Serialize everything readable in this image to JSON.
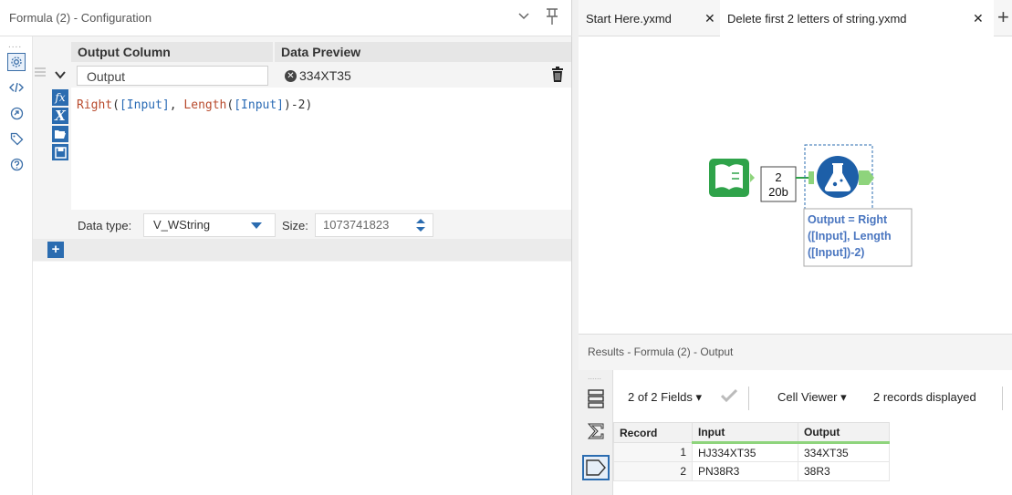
{
  "config_panel": {
    "title": "Formula (2) - Configuration",
    "columns": {
      "output_column": "Output Column",
      "data_preview": "Data Preview"
    },
    "row": {
      "output_field": "Output",
      "preview_value": "334XT35",
      "expression": {
        "fn1": "Right",
        "p1": "(",
        "f1": "[Input]",
        "c1": ", ",
        "fn2": "Length",
        "p2": "(",
        "f2": "[Input]",
        "p3": ")",
        "minus": "-",
        "n": "2",
        "p4": ")"
      },
      "data_type_label": "Data type:",
      "data_type": "V_WString",
      "size_label": "Size:",
      "size_value": "1073741823"
    },
    "add_label": "+"
  },
  "tabs": [
    {
      "label": "Start Here.yxmd",
      "active": false
    },
    {
      "label": "Delete first 2 letters of string.yxmd",
      "active": true
    }
  ],
  "canvas": {
    "connection_count": "2",
    "connection_size": "20b",
    "annotation_line1": "Output = Right",
    "annotation_line2": "([Input], Length",
    "annotation_line3": "([Input])-2)"
  },
  "results": {
    "title": "Results - Formula (2) - Output",
    "fields_label": "2 of 2 Fields",
    "cell_viewer_label": "Cell Viewer",
    "records_label": "2 records displayed",
    "headers": [
      "Record",
      "Input",
      "Output"
    ],
    "rows": [
      {
        "record": "1",
        "input": "HJ334XT35",
        "output": "334XT35"
      },
      {
        "record": "2",
        "input": "PN38R3",
        "output": "38R3"
      }
    ]
  },
  "colors": {
    "accent": "#2b6cb0",
    "tool_blue": "#1d5fa8",
    "input_green": "#2fa34a",
    "connector_green": "#8ed47c"
  }
}
